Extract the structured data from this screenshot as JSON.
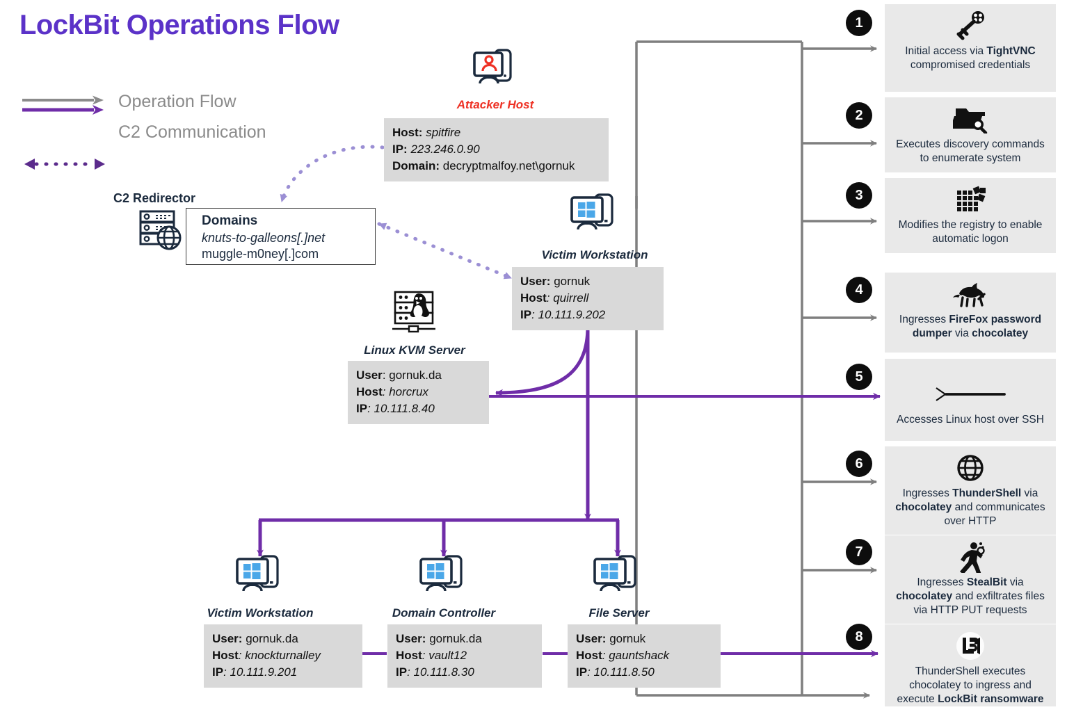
{
  "title": "LockBit Operations Flow",
  "legend": [
    {
      "glyph": "solid-arrow-pair",
      "label": "Operation Flow"
    },
    {
      "glyph": "dotted-double-arrow",
      "label": "C2 Communication"
    }
  ],
  "colors": {
    "title_purple": "#5b32c8",
    "flow_purple": "#6f2da8",
    "flow_gray": "#7f7f7f",
    "c2_dotted": "#9b8fd4",
    "attacker_red": "#ee3124",
    "info_box_bg": "#d9d9d9",
    "card_bg": "#e9e9e9",
    "badge_bg": "#0d0d0d",
    "node_label": "#1b2a3d"
  },
  "nodes": {
    "attacker": {
      "label": "Attacker Host",
      "icon": "attacker-host-monitor-icon",
      "fields": [
        {
          "key": "Host:",
          "value": "spitfire",
          "italic": true
        },
        {
          "key": "IP:",
          "value": "223.246.0.90",
          "italic": true
        },
        {
          "key": "Domain:",
          "value": "decryptmalfoy.net\\gornuk",
          "italic": false
        }
      ]
    },
    "c2_redirector": {
      "title": "C2 Redirector",
      "icon": "server-globe-icon",
      "box_title": "Domains",
      "domains": [
        "knuts-to-galleons[.]net",
        "muggle-m0ney[.]com"
      ]
    },
    "victim_workstation_top": {
      "label": "Victim Workstation",
      "icon": "windows-workstation-icon",
      "fields": [
        {
          "key": "User:",
          "value": "gornuk",
          "italic": false
        },
        {
          "key": "Host",
          "value": ": quirrell",
          "italic": true
        },
        {
          "key": "IP",
          "value": ": 10.111.9.202",
          "italic": true
        }
      ]
    },
    "linux_kvm": {
      "label": "Linux KVM Server",
      "icon": "linux-penguin-server-icon",
      "fields": [
        {
          "key": "User",
          "value": ": gornuk.da",
          "italic": false
        },
        {
          "key": "Host",
          "value": ": horcrux",
          "italic": true
        },
        {
          "key": "IP",
          "value": ": 10.111.8.40",
          "italic": true
        }
      ]
    },
    "victim_workstation_bottom": {
      "label": "Victim Workstation",
      "icon": "windows-workstation-icon",
      "fields": [
        {
          "key": "User:",
          "value": "gornuk.da",
          "italic": false
        },
        {
          "key": "Host",
          "value": ": knockturnalley",
          "italic": true
        },
        {
          "key": "IP",
          "value": ": 10.111.9.201",
          "italic": true
        }
      ]
    },
    "domain_controller": {
      "label": "Domain Controller",
      "icon": "windows-workstation-icon",
      "fields": [
        {
          "key": "User:",
          "value": "gornuk.da",
          "italic": false
        },
        {
          "key": "Host",
          "value": ": vault12",
          "italic": true
        },
        {
          "key": "IP",
          "value": ": 10.111.8.30",
          "italic": true
        }
      ]
    },
    "file_server": {
      "label": "File Server",
      "icon": "windows-workstation-icon",
      "fields": [
        {
          "key": "User:",
          "value": "gornuk",
          "italic": false
        },
        {
          "key": "Host",
          "value": ": gauntshack",
          "italic": true
        },
        {
          "key": "IP",
          "value": ": 10.111.8.50",
          "italic": true
        }
      ]
    }
  },
  "steps": [
    {
      "number": "1",
      "icon": "key-icon",
      "arrow_color": "gray",
      "text_html": "Initial access via <b>TightVNC</b> compromised credentials",
      "text_plain": "Initial access via TightVNC compromised credentials"
    },
    {
      "number": "2",
      "icon": "folder-search-icon",
      "arrow_color": "gray",
      "text_html": "Executes discovery commands to enumerate system",
      "text_plain": "Executes discovery commands to enumerate system"
    },
    {
      "number": "3",
      "icon": "registry-grid-icon",
      "arrow_color": "gray",
      "text_html": "Modifies the registry to enable automatic logon",
      "text_plain": "Modifies the registry to enable automatic logon"
    },
    {
      "number": "4",
      "icon": "firefox-fox-icon",
      "arrow_color": "gray",
      "text_html": "Ingresses <b>FireFox password dumper</b> via <b>chocolatey</b>",
      "text_plain": "Ingresses FireFox password dumper via chocolatey"
    },
    {
      "number": "5",
      "icon": "ssh-terminal-prompt-icon",
      "arrow_color": "purple",
      "text_html": "Accesses Linux host over SSH",
      "text_plain": "Accesses Linux host over SSH"
    },
    {
      "number": "6",
      "icon": "globe-icon",
      "arrow_color": "gray",
      "text_html": "Ingresses <b>ThunderShell</b> via <b>chocolatey</b> and communicates over HTTP",
      "text_plain": "Ingresses ThunderShell via chocolatey and communicates over HTTP"
    },
    {
      "number": "7",
      "icon": "running-person-icon",
      "arrow_color": "gray",
      "text_html": "Ingresses <b>StealBit</b> via <b>chocolatey</b> and exfiltrates files via HTTP PUT requests",
      "text_plain": "Ingresses StealBit via chocolatey and exfiltrates files via HTTP PUT requests"
    },
    {
      "number": "8",
      "icon": "lockbit-logo-icon",
      "arrow_color": "purple",
      "text_html": "ThunderShell executes chocolatey to ingress and execute <b>LockBit ransomware</b>",
      "text_plain": "ThunderShell executes chocolatey to ingress and execute LockBit ransomware"
    }
  ]
}
